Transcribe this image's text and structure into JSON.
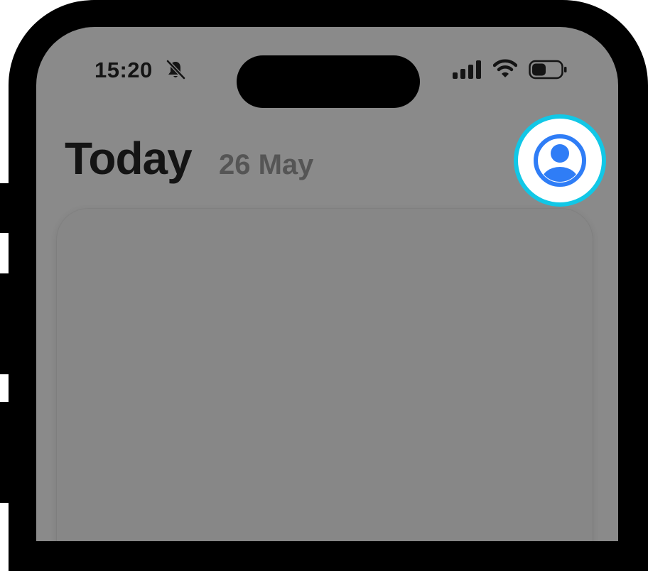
{
  "status_bar": {
    "time": "15:20",
    "icons": [
      "bell-slash-icon",
      "signal-icon",
      "wifi-icon",
      "battery-icon"
    ]
  },
  "header": {
    "title": "Today",
    "date": "26 May"
  },
  "profile": {
    "icon": "person-circle-icon",
    "accent_color": "#12c7e6",
    "icon_color": "#2f7df6"
  },
  "colors": {
    "screen_background": "#8a8a8a",
    "frame": "#000000"
  }
}
